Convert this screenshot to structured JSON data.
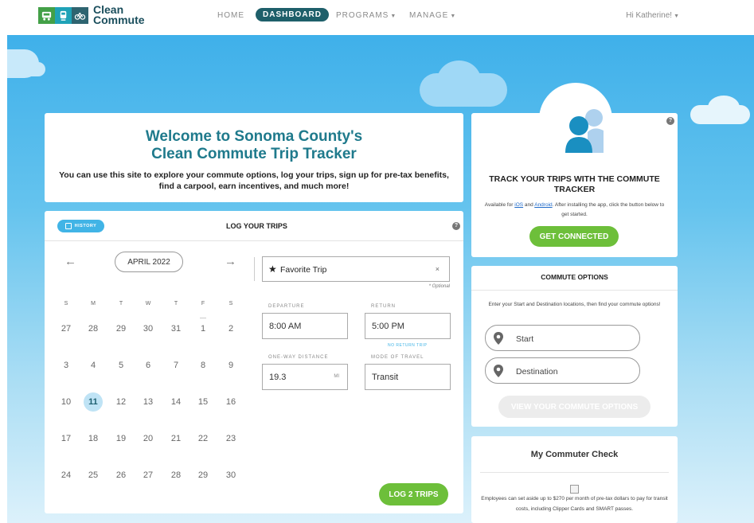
{
  "nav": {
    "logo_line1": "Clean",
    "logo_line2": "Commute",
    "home": "HOME",
    "dashboard": "DASHBOARD",
    "programs": "PROGRAMS",
    "manage": "MANAGE",
    "greeting": "Hi Katherine!"
  },
  "welcome": {
    "title_line1": "Welcome to Sonoma County's",
    "title_line2": "Clean Commute Trip Tracker",
    "description": "You can use this site to explore your commute options, log your trips, sign up for pre-tax benefits, find a carpool, earn incentives, and much more!"
  },
  "log_trips": {
    "history_label": "HISTORY",
    "title": "LOG YOUR TRIPS",
    "help": "?",
    "prev_arrow": "←",
    "next_arrow": "→",
    "month": "APRIL 2022",
    "weekdays": [
      "S",
      "M",
      "T",
      "W",
      "T",
      "F",
      "S"
    ],
    "weeks": [
      [
        "27",
        "28",
        "29",
        "30",
        "31",
        "1",
        "2"
      ],
      [
        "3",
        "4",
        "5",
        "6",
        "7",
        "8",
        "9"
      ],
      [
        "10",
        "11",
        "12",
        "13",
        "14",
        "15",
        "16"
      ],
      [
        "17",
        "18",
        "19",
        "20",
        "21",
        "22",
        "23"
      ],
      [
        "24",
        "25",
        "26",
        "27",
        "28",
        "29",
        "30"
      ]
    ],
    "selected_day": "11",
    "favorite_trip": "Favorite Trip",
    "clear_glyph": "×",
    "optional": "* Optional",
    "departure_label": "DEPARTURE",
    "departure_value": "8:00 AM",
    "return_label": "RETURN",
    "return_value": "5:00 PM",
    "no_return": "NO RETURN TRIP",
    "distance_label": "ONE-WAY DISTANCE",
    "distance_value": "19.3",
    "distance_unit": "MI",
    "mode_label": "MODE OF TRAVEL",
    "mode_value": "Transit",
    "log_button": "LOG 2 TRIPS"
  },
  "track": {
    "help": "?",
    "title_line1": "TRACK YOUR TRIPS WITH THE COMMUTE",
    "title_line2": "TRACKER",
    "text_available": "Available for",
    "ios": "iOS",
    "and": "and",
    "android": "Android",
    "text_rest": ". After installing the app, click the button below to get started.",
    "button": "GET CONNECTED"
  },
  "commute_options": {
    "title": "COMMUTE OPTIONS",
    "description": "Enter your Start and Destination locations, then find your commute options!",
    "start_placeholder": "Start",
    "destination_placeholder": "Destination",
    "button": "VIEW YOUR COMMUTE OPTIONS"
  },
  "commuter_check": {
    "title": "My Commuter Check",
    "description": "Employees can set aside up to $270 per month of pre-tax dollars to pay for transit costs, including Clipper Cards and SMART passes."
  },
  "colors": {
    "brand_teal": "#1f7a8c",
    "nav_active": "#1e5f6a",
    "button_green": "#6dbf3a",
    "accent_blue": "#41b4e6"
  }
}
